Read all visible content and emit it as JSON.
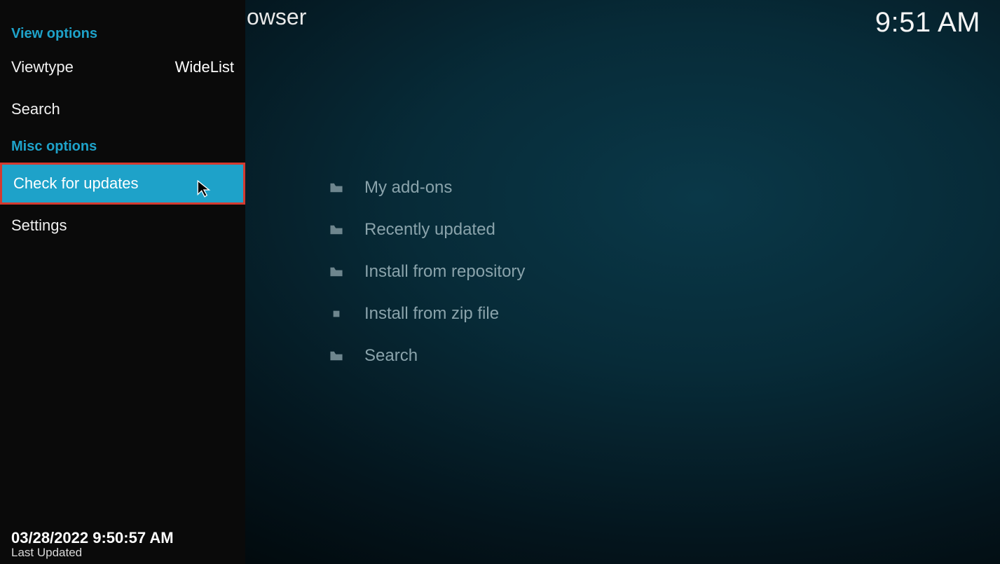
{
  "clock": "9:51 AM",
  "peek_title": "owser",
  "sidebar": {
    "view_options_header": "View options",
    "viewtype_label": "Viewtype",
    "viewtype_value": "WideList",
    "search_label": "Search",
    "misc_options_header": "Misc options",
    "check_updates_label": "Check for updates",
    "settings_label": "Settings",
    "footer_timestamp": "03/28/2022 9:50:57 AM",
    "footer_label": "Last Updated"
  },
  "main": {
    "items": [
      {
        "label": "My add-ons",
        "icon": "folder"
      },
      {
        "label": "Recently updated",
        "icon": "folder"
      },
      {
        "label": "Install from repository",
        "icon": "folder"
      },
      {
        "label": "Install from zip file",
        "icon": "zip"
      },
      {
        "label": "Search",
        "icon": "folder"
      }
    ]
  }
}
